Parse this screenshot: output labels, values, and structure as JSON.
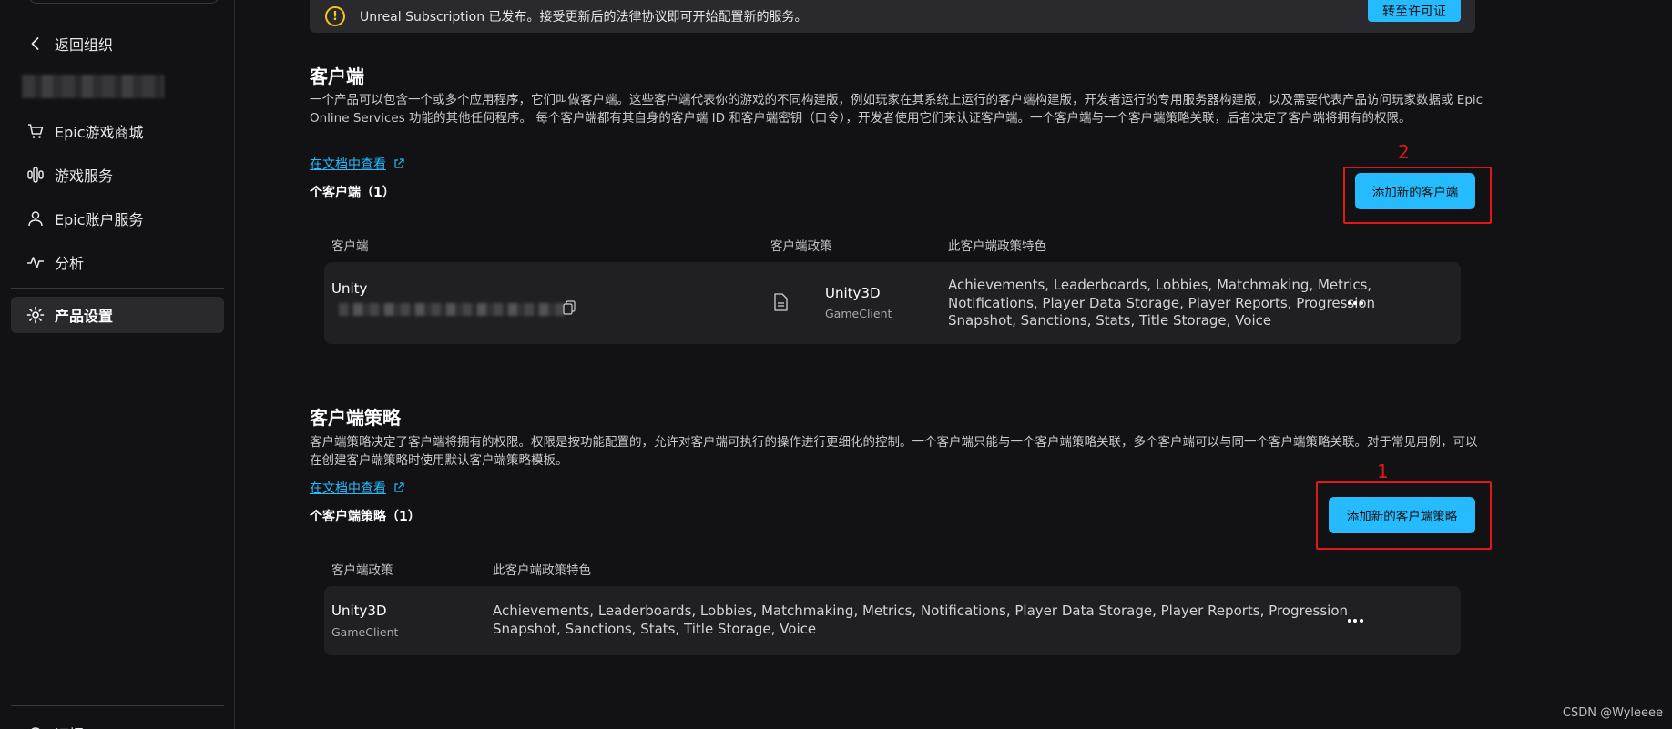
{
  "sidebar": {
    "back_label": "返回组织",
    "items": [
      {
        "label": "Epic游戏商城",
        "icon": "cart-icon"
      },
      {
        "label": "游戏服务",
        "icon": "game-services-icon"
      },
      {
        "label": "Epic账户服务",
        "icon": "user-icon"
      },
      {
        "label": "分析",
        "icon": "analytics-icon"
      },
      {
        "label": "产品设置",
        "icon": "gear-icon"
      }
    ],
    "bottom_partial_label": "证据"
  },
  "banner": {
    "text": "Unreal Subscription 已发布。接受更新后的法律协议即可开始配置新的服务。",
    "button_label": "转至许可证"
  },
  "clients": {
    "title": "客户端",
    "description": "一个产品可以包含一个或多个应用程序，它们叫做客户端。这些客户端代表你的游戏的不同构建版，例如玩家在其系统上运行的客户端构建版，开发者运行的专用服务器构建版，以及需要代表产品访问玩家数据或 Epic Online Services 功能的其他任何程序。 每个客户端都有其自身的客户端 ID 和客户端密钥（口令），开发者使用它们来认证客户端。一个客户端与一个客户端策略关联，后者决定了客户端将拥有的权限。",
    "doc_link": "在文档中查看",
    "count_label": "个客户端（1）",
    "add_button": "添加新的客户端",
    "annotation_number": "2",
    "columns": [
      "客户端",
      "客户端政策",
      "此客户端政策特色"
    ],
    "rows": [
      {
        "name": "Unity",
        "policy_name": "Unity3D",
        "policy_type": "GameClient",
        "features": "Achievements, Leaderboards, Lobbies, Matchmaking, Metrics, Notifications, Player Data Storage, Player Reports, Progression Snapshot, Sanctions, Stats, Title Storage, Voice"
      }
    ]
  },
  "policies": {
    "title": "客户端策略",
    "description": "客户端策略决定了客户端将拥有的权限。权限是按功能配置的，允许对客户端可执行的操作进行更细化的控制。一个客户端只能与一个客户端策略关联，多个客户端可以与同一个客户端策略关联。对于常见用例，可以在创建客户端策略时使用默认客户端策略模板。",
    "doc_link": "在文档中查看",
    "count_label": "个客户端策略（1）",
    "add_button": "添加新的客户端策略",
    "annotation_number": "1",
    "columns": [
      "客户端政策",
      "此客户端政策特色"
    ],
    "rows": [
      {
        "name": "Unity3D",
        "type": "GameClient",
        "features": "Achievements, Leaderboards, Lobbies, Matchmaking, Metrics, Notifications, Player Data Storage, Player Reports, Progression Snapshot, Sanctions, Stats, Title Storage, Voice"
      }
    ]
  },
  "watermark": "CSDN @Wyleeee",
  "colors": {
    "background": "#121214",
    "accent": "#26bbff",
    "annotation": "#e01818",
    "card": "#202024",
    "warning": "#f5c518"
  }
}
